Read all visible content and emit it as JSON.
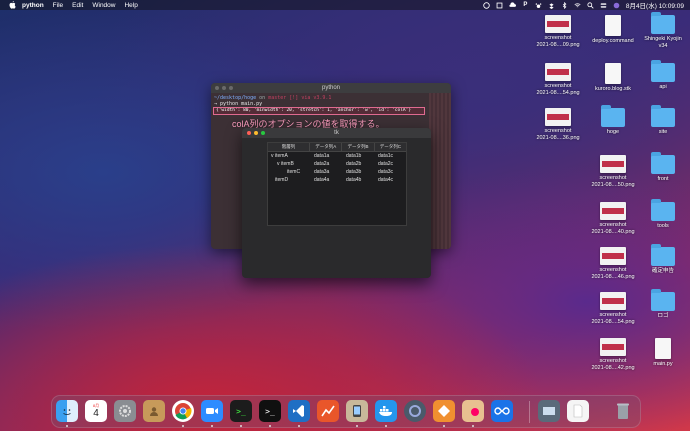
{
  "menubar": {
    "app_name": "python",
    "items": [
      "File",
      "Edit",
      "Window",
      "Help"
    ],
    "clock": "8月4日(水) 10:09:09"
  },
  "terminal": {
    "title": "python",
    "line1_path": "~/desktop/hoge",
    "line1_on": "on",
    "line1_git": " master [!] via ",
    "line1_ver": "v3.9.1",
    "line2": "→ python main.py",
    "highlight": "{'width': 80, 'minwidth': 20, 'stretch': 1, 'anchor': 'w', 'id': 'colA'}"
  },
  "annotation": "colA列のオプションの値を取得する。",
  "tk": {
    "title": "tk",
    "columns": [
      "階層列",
      "データ列A",
      "データ列B",
      "データ列C"
    ],
    "rows": [
      {
        "indent": 0,
        "toggle": "v",
        "name": "itemA",
        "cells": [
          "data1a",
          "data1b",
          "data1c"
        ]
      },
      {
        "indent": 1,
        "toggle": "v",
        "name": "itemB",
        "cells": [
          "data2a",
          "data2b",
          "data2c"
        ]
      },
      {
        "indent": 2,
        "toggle": "",
        "name": "itemC",
        "cells": [
          "data3a",
          "data3b",
          "data3c"
        ]
      },
      {
        "indent": 0,
        "toggle": "",
        "name": "itemD",
        "cells": [
          "data4a",
          "data4b",
          "data4c"
        ]
      }
    ]
  },
  "desktop": [
    {
      "label": "screenshot\n2021-08....09.png",
      "kind": "thumb"
    },
    {
      "label": "deploy.command",
      "kind": "doc"
    },
    {
      "label": "Shingeki Kyojin\nv34",
      "kind": "folder"
    },
    {
      "label": "screenshot\n2021-08....54.png",
      "kind": "thumb"
    },
    {
      "label": "kuroro.blog.stk",
      "kind": "doc"
    },
    {
      "label": "api",
      "kind": "folder"
    },
    {
      "label": "screenshot\n2021-08....36.png",
      "kind": "thumb"
    },
    {
      "label": "hoge",
      "kind": "folder"
    },
    {
      "label": "site",
      "kind": "folder"
    },
    {
      "label": "screenshot\n2021-08....50.png",
      "kind": "thumb"
    },
    {
      "label": "front",
      "kind": "folder"
    },
    {
      "label": "screenshot\n2021-08....40.png",
      "kind": "thumb"
    },
    {
      "label": "tools",
      "kind": "folder"
    },
    {
      "label": "screenshot\n2021-08....46.png",
      "kind": "thumb"
    },
    {
      "label": "確定申告",
      "kind": "folder"
    },
    {
      "label": "screenshot\n2021-08....54.png",
      "kind": "thumb"
    },
    {
      "label": "ロゴ",
      "kind": "folder"
    },
    {
      "label": "screenshot\n2021-08....42.png",
      "kind": "thumb"
    },
    {
      "label": "main.py",
      "kind": "doc"
    }
  ],
  "dock": {
    "calendar_month": "8月",
    "calendar_day": "4",
    "apps": [
      "finder",
      "calendar",
      "system-preferences",
      "contacts",
      "chrome",
      "zoom",
      "terminal-1",
      "terminal-2",
      "vscode",
      "instruments",
      "simulator",
      "docker",
      "quicktime",
      "git",
      "preview",
      "remote",
      "image-capture",
      "document",
      "trash"
    ]
  },
  "colors": {
    "terminal_bg": "#3c3035",
    "highlight_border": "#e06a90",
    "annotation": "#ff9ec0",
    "folder": "#5ab4f0"
  }
}
